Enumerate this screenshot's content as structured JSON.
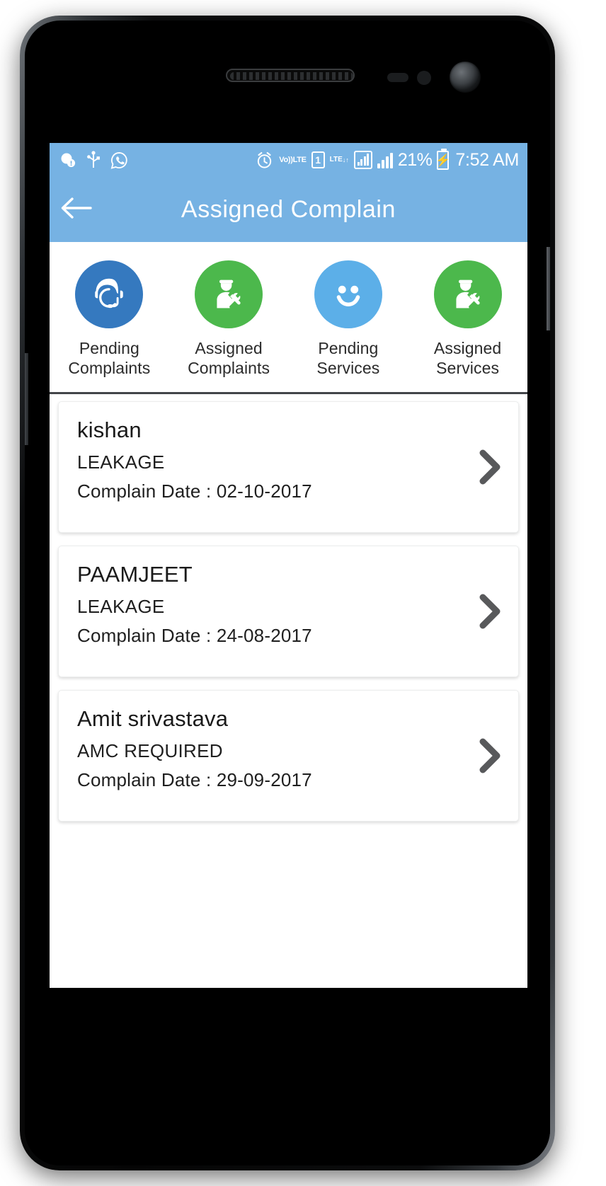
{
  "status_bar": {
    "left_icons": [
      {
        "name": "app-alert-icon",
        "glyph": "ⓘ"
      },
      {
        "name": "usb-icon",
        "glyph": "Ψ"
      },
      {
        "name": "whatsapp-icon",
        "glyph": "✆"
      }
    ],
    "alarm_icon": "alarm-icon",
    "volte_line1": "Vo))",
    "volte_line2": "LTE",
    "sim_label": "1",
    "lte_label": "LTE",
    "lte_arrows": "↓↑",
    "battery_percent": "21%",
    "battery_bolt": "⚡",
    "time": "7:52 AM"
  },
  "app_bar": {
    "back_icon": "back-arrow-icon",
    "title": "Assigned Complain"
  },
  "tabs": [
    {
      "label_line1": "Pending",
      "label_line2": "Complaints",
      "icon": "headset-support-agent-icon",
      "color": "#3579bf"
    },
    {
      "label_line1": "Assigned",
      "label_line2": "Complaints",
      "icon": "technician-wrench-icon",
      "color": "#4cb84c"
    },
    {
      "label_line1": "Pending",
      "label_line2": "Services",
      "icon": "smiley-face-icon",
      "color": "#5cafe8"
    },
    {
      "label_line1": "Assigned",
      "label_line2": "Services",
      "icon": "technician-wrench-icon",
      "color": "#4cb84c"
    }
  ],
  "complaints": [
    {
      "name": "kishan",
      "type": "LEAKAGE",
      "date": "Complain Date : 02-10-2017",
      "chevron": "chevron-right-icon"
    },
    {
      "name": "PAAMJEET",
      "type": "LEAKAGE",
      "date": "Complain Date : 24-08-2017",
      "chevron": "chevron-right-icon"
    },
    {
      "name": "Amit srivastava",
      "type": "AMC REQUIRED",
      "date": "Complain Date : 29-09-2017",
      "chevron": "chevron-right-icon"
    }
  ],
  "theme": {
    "accent_blue": "#76b2e3",
    "icon_blue_dark": "#3579bf",
    "icon_blue_light": "#5cafe8",
    "icon_green": "#4cb84c",
    "chevron_gray": "#58595b",
    "divider_dark": "#434549"
  }
}
